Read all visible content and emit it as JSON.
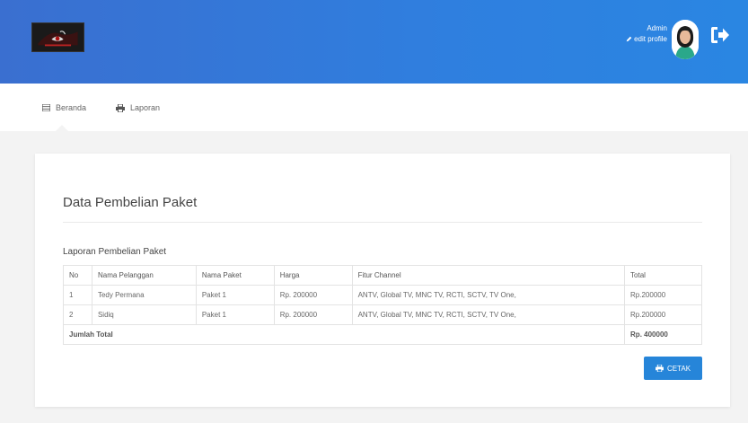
{
  "header": {
    "admin_name": "Admin",
    "edit_profile": "edit profile"
  },
  "nav": {
    "items": [
      {
        "label": "Beranda",
        "icon": "list-icon"
      },
      {
        "label": "Laporan",
        "icon": "printer-icon"
      }
    ]
  },
  "main": {
    "page_title": "Data Pembelian Paket",
    "section_title": "Laporan Pembelian Paket",
    "table": {
      "headers": [
        "No",
        "Nama Pelanggan",
        "Nama Paket",
        "Harga",
        "Fitur Channel",
        "Total"
      ],
      "rows": [
        [
          "1",
          "Tedy Permana",
          "Paket 1",
          "Rp. 200000",
          "ANTV, Global TV, MNC TV, RCTI, SCTV, TV One,",
          "Rp.200000"
        ],
        [
          "2",
          "Sidiq",
          "Paket 1",
          "Rp. 200000",
          "ANTV, Global TV, MNC TV, RCTI, SCTV, TV One,",
          "Rp.200000"
        ]
      ],
      "footer_label": "Jumlah Total",
      "footer_total": "Rp. 400000"
    },
    "print_button": "CETAK"
  },
  "colors": {
    "header_blue": "#2f7fdf",
    "button_blue": "#2685d9",
    "page_bg": "#f3f3f3"
  }
}
